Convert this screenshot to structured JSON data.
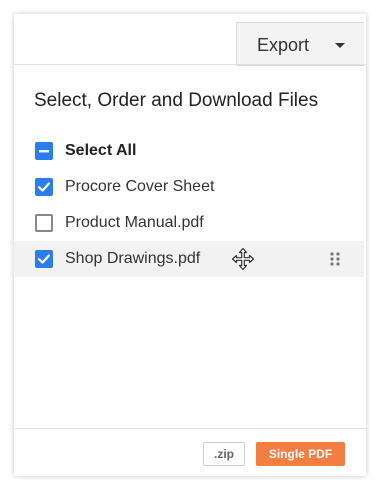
{
  "header": {
    "export_label": "Export"
  },
  "dialog": {
    "title": "Select, Order and Download Files",
    "select_all_label": "Select All",
    "files": [
      {
        "label": "Procore Cover Sheet",
        "checked": true
      },
      {
        "label": "Product Manual.pdf",
        "checked": false
      },
      {
        "label": "Shop Drawings.pdf",
        "checked": true
      }
    ]
  },
  "footer": {
    "zip_label": ".zip",
    "single_pdf_label": "Single PDF"
  },
  "colors": {
    "accent": "#2b7de9",
    "primary_button": "#f47e42"
  },
  "icons": {
    "move": "move-icon",
    "drag": "drag-handle-icon",
    "caret": "chevron-down-icon"
  }
}
